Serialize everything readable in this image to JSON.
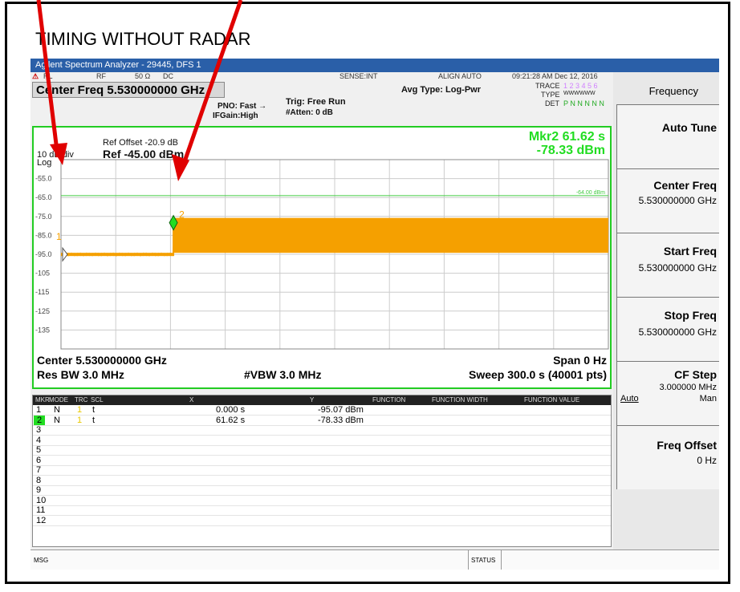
{
  "annotation": {
    "title": "TIMING WITHOUT RADAR"
  },
  "window": {
    "title": "Agilent Spectrum Analyzer - 29445, DFS 1"
  },
  "statusbar": {
    "rl": "RL",
    "rf": "RF",
    "impedance": "50 Ω",
    "coupling": "DC",
    "sense": "SENSE:INT",
    "align": "ALIGN AUTO",
    "timestamp": "09:21:28 AM Dec 12, 2016"
  },
  "header": {
    "center_freq": "Center Freq  5.530000000 GHz",
    "avg_type": "Avg Type: Log-Pwr",
    "pno": "PNO: Fast",
    "ifgain": "IFGain:High",
    "trig": "Trig: Free Run",
    "atten": "#Atten: 0 dB",
    "trace_label": "TRACE",
    "trace_nums": "1 2 3 4 5 6",
    "type_label": "TYPE",
    "type_val": "WWWWWW",
    "det_label": "DET",
    "det_val": "P N N N N N"
  },
  "plot": {
    "ref_offset": "Ref Offset -20.9 dB",
    "ref_level": "Ref -45.00 dBm",
    "scale": "10 dB/div",
    "scale_type": "Log",
    "marker_readout": "Mkr2 61.62 s",
    "marker_level": "-78.33 dBm",
    "display_line_label": "-64.00 dBm",
    "center": "Center 5.530000000 GHz",
    "span": "Span 0 Hz",
    "res_bw": "Res BW 3.0 MHz",
    "vbw": "#VBW 3.0 MHz",
    "sweep": "Sweep  300.0 s (40001 pts)",
    "marker1_label": "1",
    "marker2_label": "2"
  },
  "chart_data": {
    "type": "line",
    "xlim": [
      0,
      300
    ],
    "ylim": [
      -145,
      -45
    ],
    "ytick_labels": [
      "-55.0",
      "-65.0",
      "-75.0",
      "-85.0",
      "-95.0",
      "-105",
      "-115",
      "-125",
      "-135"
    ],
    "yticks": [
      -55,
      -65,
      -75,
      -85,
      -95,
      -105,
      -115,
      -125,
      -135
    ],
    "display_line": -64,
    "series": [
      {
        "x": [
          0,
          61.6,
          61.62,
          300
        ],
        "y": [
          -95.07,
          -95.07,
          -78.33,
          -78.33
        ],
        "color": "#f5a000"
      }
    ],
    "markers": [
      {
        "label": "1",
        "x": 0,
        "y": -95.07
      },
      {
        "label": "2",
        "x": 61.62,
        "y": -78.33
      }
    ]
  },
  "marker_table": {
    "headers": [
      "MKR",
      "MODE",
      "TRC",
      "SCL",
      "X",
      "Y",
      "FUNCTION",
      "FUNCTION WIDTH",
      "FUNCTION VALUE"
    ],
    "rows": [
      {
        "mkr": "1",
        "mode": "N",
        "trc": "1",
        "scl": "t",
        "x": "0.000 s",
        "y": "-95.07 dBm"
      },
      {
        "mkr": "2",
        "mode": "N",
        "trc": "1",
        "scl": "t",
        "x": "61.62 s",
        "y": "-78.33 dBm"
      },
      {
        "mkr": "3"
      },
      {
        "mkr": "4"
      },
      {
        "mkr": "5"
      },
      {
        "mkr": "6"
      },
      {
        "mkr": "7"
      },
      {
        "mkr": "8"
      },
      {
        "mkr": "9"
      },
      {
        "mkr": "10"
      },
      {
        "mkr": "11"
      },
      {
        "mkr": "12"
      }
    ]
  },
  "softkeys": {
    "menu_title": "Frequency",
    "auto_tune": "Auto Tune",
    "center_freq": "Center Freq",
    "center_freq_val": "5.530000000 GHz",
    "start_freq": "Start Freq",
    "start_freq_val": "5.530000000 GHz",
    "stop_freq": "Stop Freq",
    "stop_freq_val": "5.530000000 GHz",
    "cf_step": "CF Step",
    "cf_step_val": "3.000000 MHz",
    "cf_step_auto": "Auto",
    "cf_step_man": "Man",
    "freq_offset": "Freq Offset",
    "freq_offset_val": "0 Hz"
  },
  "msgbar": {
    "msg": "MSG",
    "status": "STATUS"
  },
  "colors": {
    "trace": "#f5a000",
    "accent": "#22dd22",
    "arrow": "#e00000"
  }
}
